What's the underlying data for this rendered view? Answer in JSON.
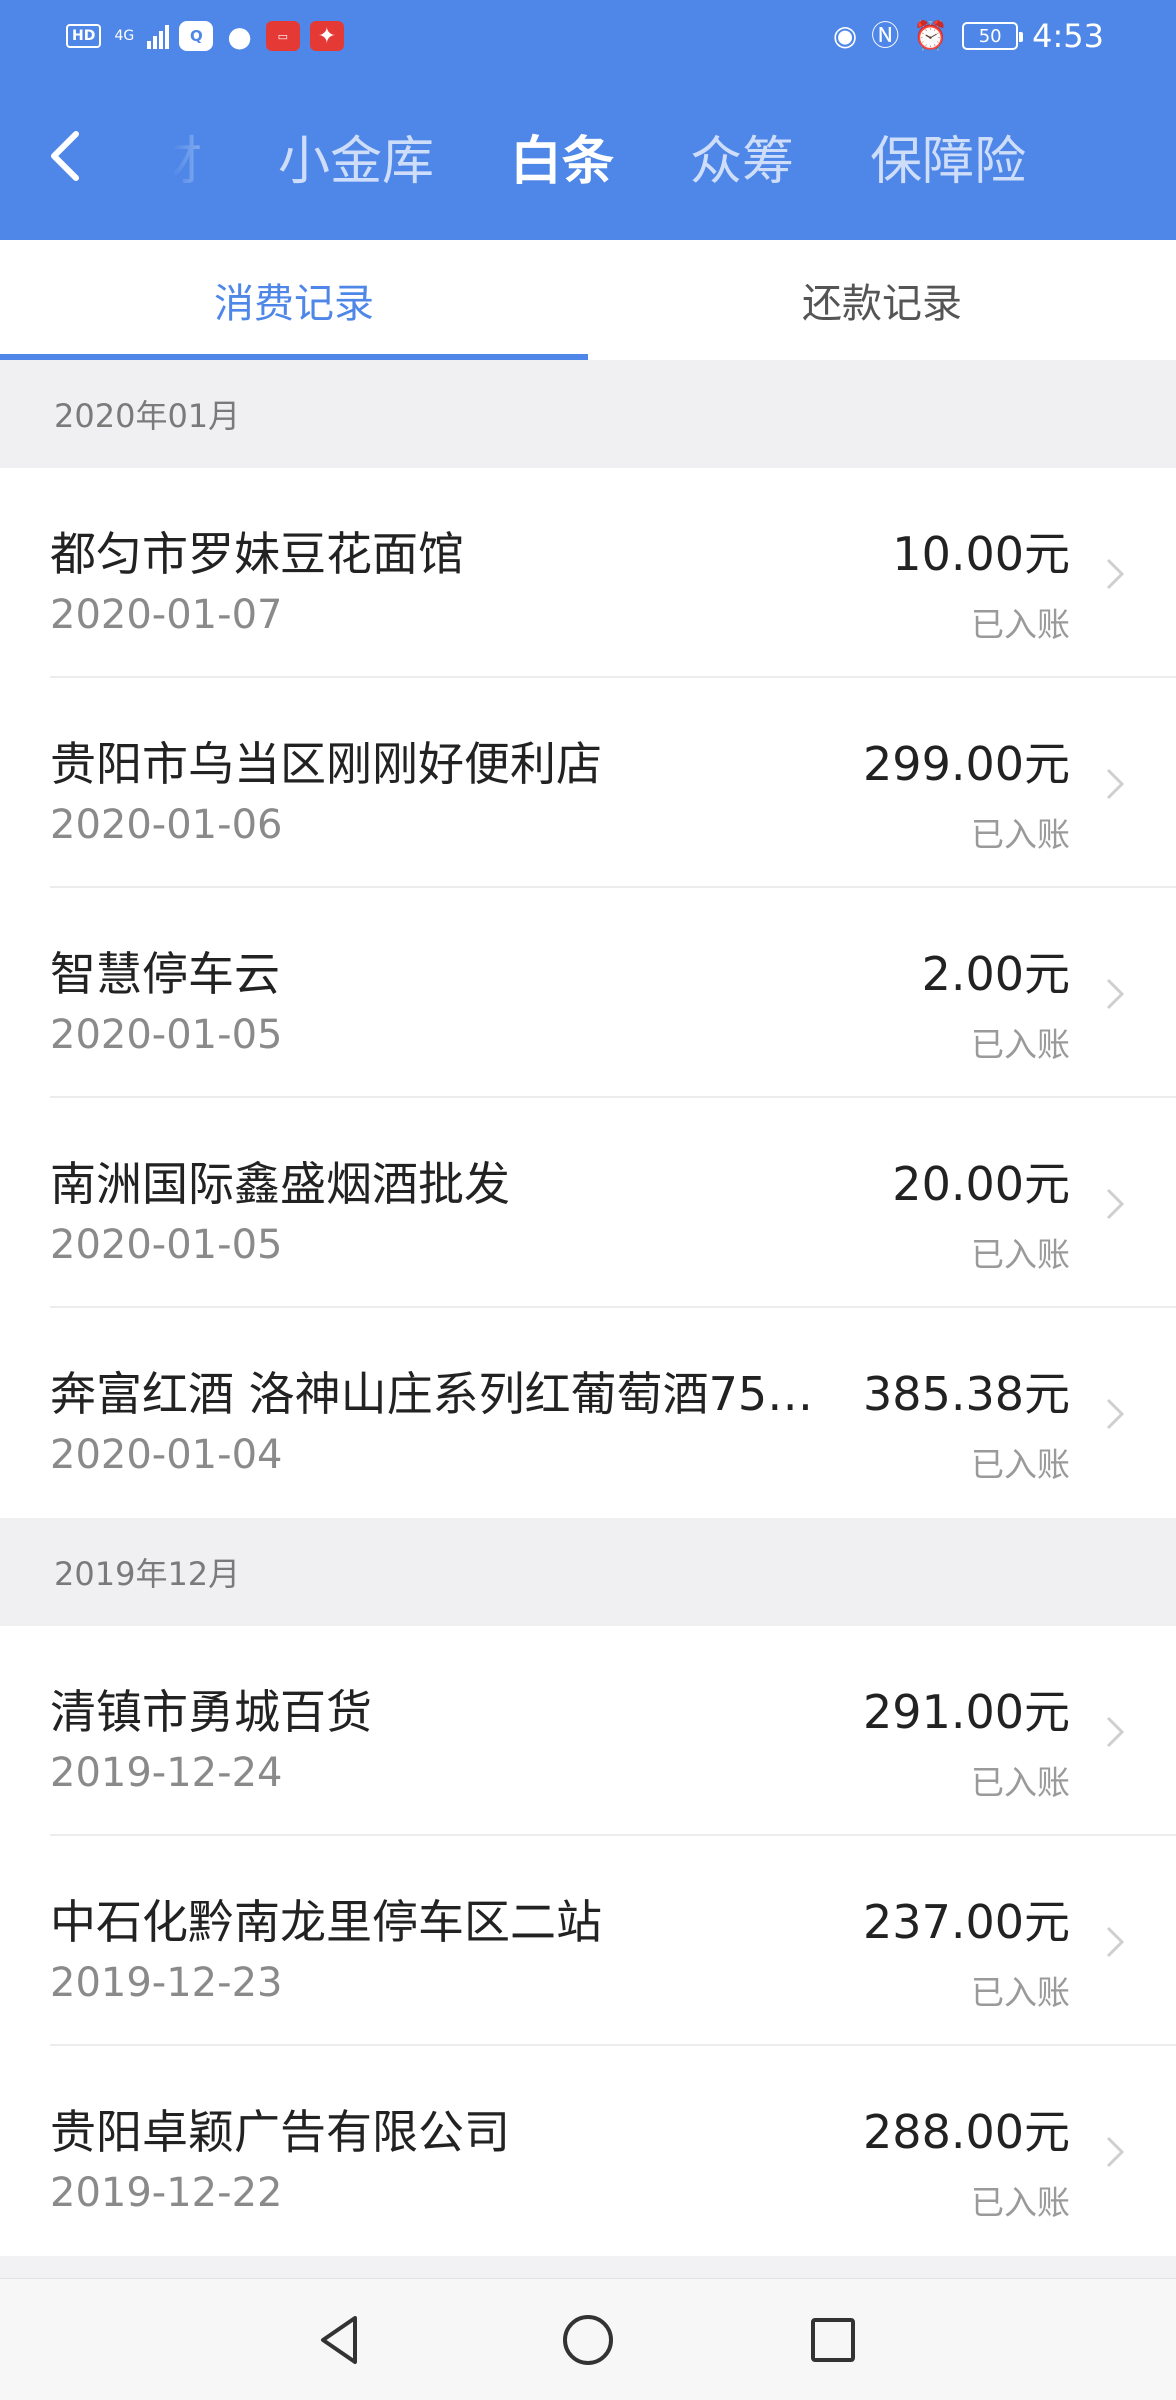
{
  "status_bar": {
    "hd": "HD",
    "network": "4G",
    "battery": "50",
    "time": "4:53",
    "icons_left": [
      "hd-icon",
      "signal-icon",
      "app-icon",
      "message-icon",
      "app-icon",
      "app-icon"
    ],
    "icons_right": [
      "eye-comfort-icon",
      "nfc-icon",
      "alarm-icon",
      "battery-icon"
    ]
  },
  "header": {
    "tabs": [
      {
        "label": "财"
      },
      {
        "label": "小金库"
      },
      {
        "label": "白条",
        "active": true
      },
      {
        "label": "众筹"
      },
      {
        "label": "保障险"
      }
    ]
  },
  "subtabs": [
    {
      "label": "消费记录",
      "active": true
    },
    {
      "label": "还款记录"
    }
  ],
  "groups": [
    {
      "month": "2020年01月",
      "rows": [
        {
          "merchant": "都匀市罗妹豆花面馆",
          "date": "2020-01-07",
          "amount": "10.00元",
          "status": "已入账"
        },
        {
          "merchant": "贵阳市乌当区刚刚好便利店",
          "date": "2020-01-06",
          "amount": "299.00元",
          "status": "已入账"
        },
        {
          "merchant": "智慧停车云",
          "date": "2020-01-05",
          "amount": "2.00元",
          "status": "已入账"
        },
        {
          "merchant": "南洲国际鑫盛烟酒批发",
          "date": "2020-01-05",
          "amount": "20.00元",
          "status": "已入账"
        },
        {
          "merchant": "奔富红酒 洛神山庄系列红葡萄酒75…",
          "date": "2020-01-04",
          "amount": "385.38元",
          "status": "已入账"
        }
      ]
    },
    {
      "month": "2019年12月",
      "rows": [
        {
          "merchant": "清镇市勇城百货",
          "date": "2019-12-24",
          "amount": "291.00元",
          "status": "已入账"
        },
        {
          "merchant": "中石化黔南龙里停车区二站",
          "date": "2019-12-23",
          "amount": "237.00元",
          "status": "已入账"
        },
        {
          "merchant": "贵阳卓颖广告有限公司",
          "date": "2019-12-22",
          "amount": "288.00元",
          "status": "已入账"
        }
      ]
    }
  ],
  "colors": {
    "header_bg": "#4f87e8",
    "accent": "#4f87e8",
    "section_bg": "#f0f0f2"
  }
}
